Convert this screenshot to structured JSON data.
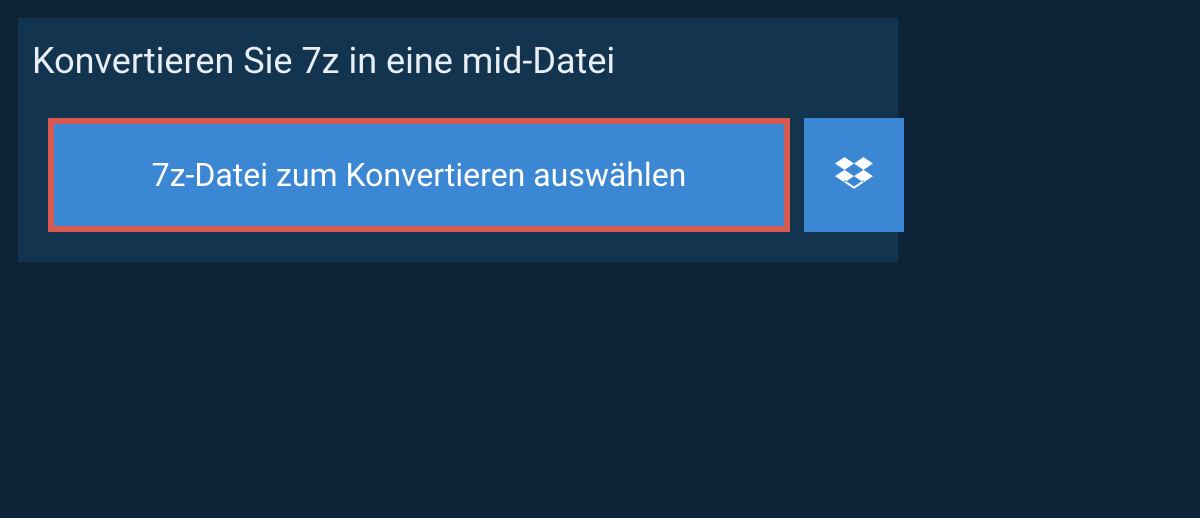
{
  "heading": "Konvertieren Sie 7z in eine mid-Datei",
  "select_button_label": "7z-Datei zum Konvertieren auswählen",
  "colors": {
    "background": "#0d2438",
    "panel": "#12344f",
    "button": "#3b87d3",
    "highlight_border": "#d65a50",
    "text_light": "#e8eef3",
    "text_white": "#ffffff"
  }
}
